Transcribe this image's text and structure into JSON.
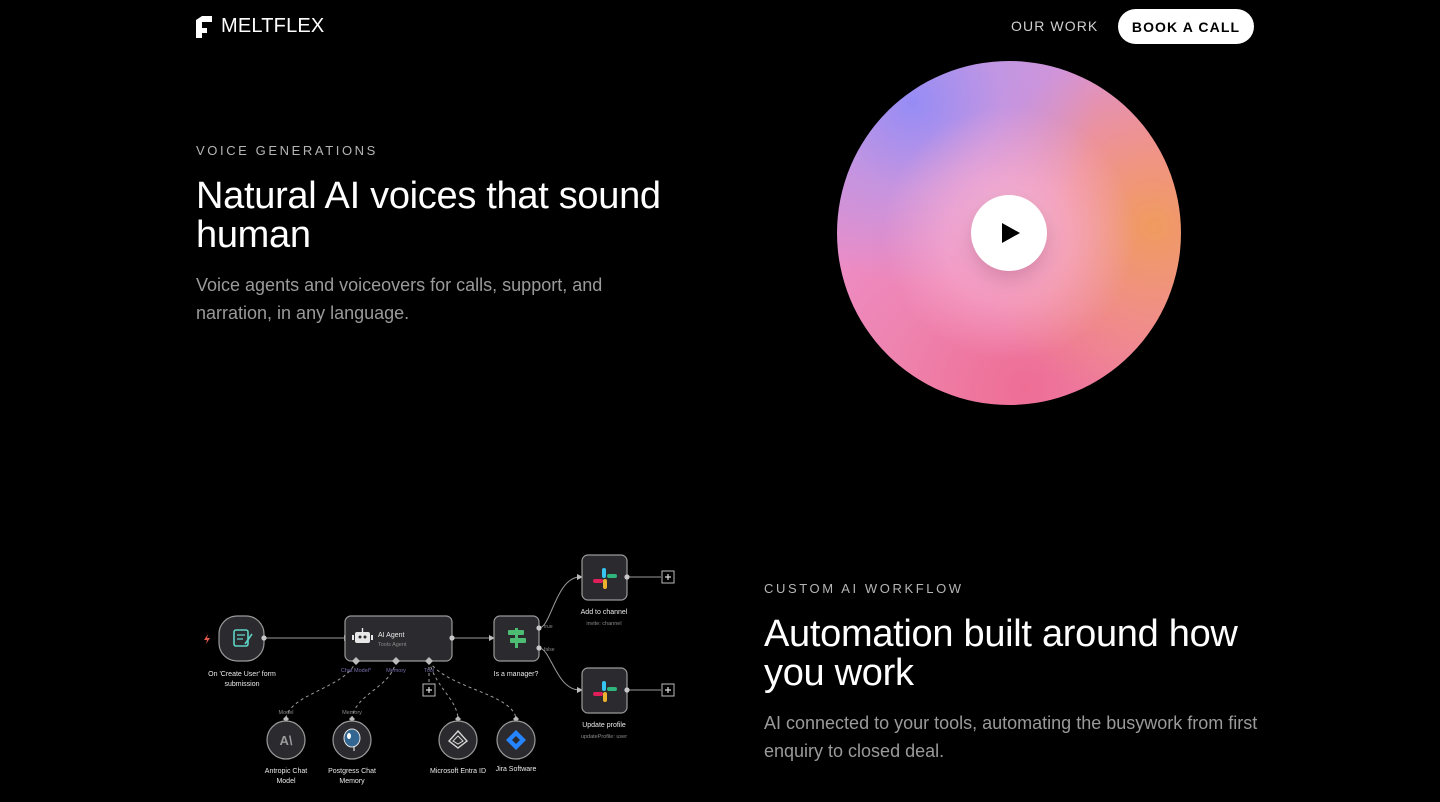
{
  "header": {
    "brand": "MELTFLEX",
    "nav": [
      "OUR WORK"
    ],
    "cta": "BOOK A CALL"
  },
  "voice_section": {
    "eyebrow": "VOICE GENERATIONS",
    "headline": "Natural AI voices that sound human",
    "description": "Voice agents and voiceovers for calls, support, and narration, in any language.",
    "play_icon": "play-icon"
  },
  "workflow_section": {
    "eyebrow": "CUSTOM AI WORKFLOW",
    "headline": "Automation built around how you work",
    "description": "AI connected to your tools, automating the busywork from first enquiry to closed deal."
  },
  "workflow_diagram": {
    "trigger": {
      "label_line1": "On 'Create User' form",
      "label_line2": "submission"
    },
    "agent": {
      "title": "AI Agent",
      "subtitle": "Tools Agent",
      "ports": [
        "Chat Model*",
        "Memory",
        "Tool"
      ]
    },
    "condition": {
      "label": "Is a manager?",
      "true_label": "true",
      "false_label": "false"
    },
    "slack_add": {
      "label": "Add to channel",
      "sublabel": "invite: channel"
    },
    "slack_update": {
      "label": "Update profile",
      "sublabel": "updateProfile: user"
    },
    "model": {
      "port": "Model",
      "label_line1": "Antropic Chat",
      "label_line2": "Model"
    },
    "memory": {
      "port": "Memory",
      "label_line1": "Postgress Chat",
      "label_line2": "Memory"
    },
    "entra": {
      "label": "Microsoft Entra ID"
    },
    "jira": {
      "label": "Jira Software"
    }
  }
}
